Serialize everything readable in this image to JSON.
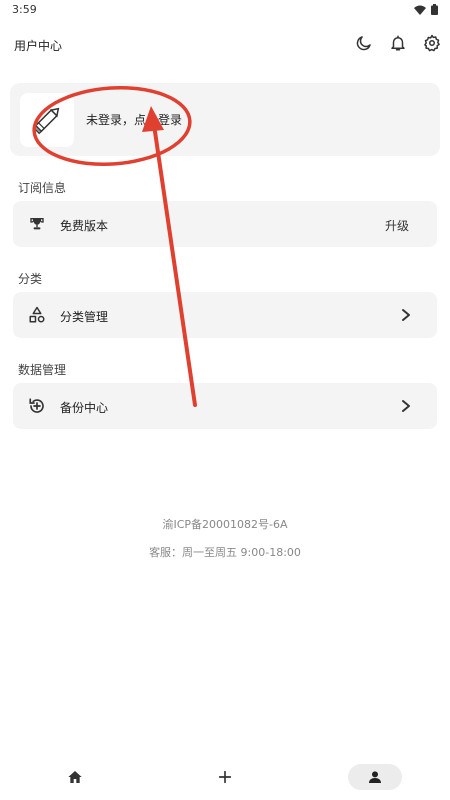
{
  "status_bar": {
    "time": "3:59",
    "icons": [
      "wifi-icon",
      "battery-icon"
    ]
  },
  "header": {
    "title": "用户中心",
    "icons": [
      "moon-icon",
      "bell-icon",
      "gear-icon"
    ]
  },
  "user_card": {
    "login_text": "未登录，点击登录"
  },
  "subscription": {
    "section_title": "订阅信息",
    "label": "免费版本",
    "action": "升级"
  },
  "category": {
    "section_title": "分类",
    "label": "分类管理"
  },
  "data_management": {
    "section_title": "数据管理",
    "label": "备份中心"
  },
  "footer": {
    "icp": "渝ICP备20001082号-6A",
    "service": "客服：周一至周五 9:00-18:00"
  },
  "bottom_nav": {
    "items": [
      "home-icon",
      "plus-icon",
      "user-icon"
    ],
    "active": "user-icon"
  },
  "colors": {
    "card_background": "#f4f4f4",
    "annotation_red": "#e04030",
    "footer_text": "#888888"
  }
}
